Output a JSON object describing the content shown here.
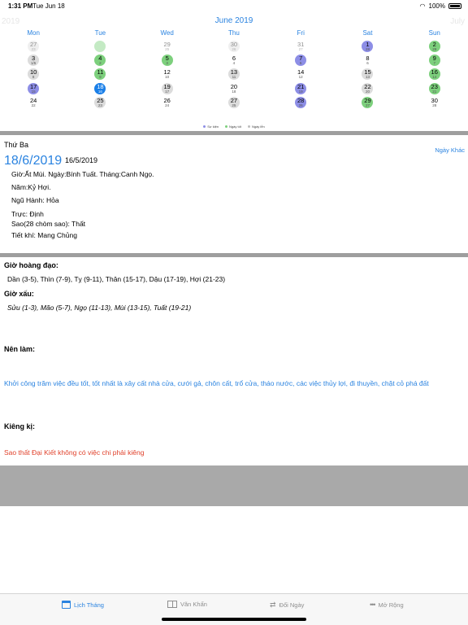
{
  "status_bar": {
    "time": "1:31 PM",
    "date": "Tue Jun 18",
    "battery": "100%"
  },
  "calendar": {
    "prev_label": "2019",
    "title": "June 2019",
    "next_label": "July",
    "weekdays": [
      "Mon",
      "Tue",
      "Wed",
      "Thu",
      "Fri",
      "Sat",
      "Sun"
    ],
    "weeks": [
      [
        {
          "d": "27",
          "l": "23",
          "c": "gray",
          "o": true
        },
        {
          "d": "",
          "l": "",
          "c": "green",
          "o": true
        },
        {
          "d": "29",
          "l": "25",
          "c": "none",
          "o": true
        },
        {
          "d": "30",
          "l": "26",
          "c": "gray",
          "o": true
        },
        {
          "d": "31",
          "l": "27",
          "c": "none",
          "o": true
        },
        {
          "d": "1",
          "l": "28",
          "c": "purple",
          "o": false
        },
        {
          "d": "2",
          "l": "29",
          "c": "green",
          "o": false
        }
      ],
      [
        {
          "d": "3",
          "l": "1/5",
          "c": "gray",
          "o": false
        },
        {
          "d": "4",
          "l": "2",
          "c": "green",
          "o": false
        },
        {
          "d": "5",
          "l": "3",
          "c": "green",
          "o": false
        },
        {
          "d": "6",
          "l": "4",
          "c": "none",
          "o": false
        },
        {
          "d": "7",
          "l": "5",
          "c": "purple",
          "o": false
        },
        {
          "d": "8",
          "l": "6",
          "c": "none",
          "o": false
        },
        {
          "d": "9",
          "l": "7",
          "c": "green",
          "o": false
        }
      ],
      [
        {
          "d": "10",
          "l": "8",
          "c": "gray",
          "o": false
        },
        {
          "d": "11",
          "l": "9",
          "c": "green",
          "o": false
        },
        {
          "d": "12",
          "l": "10",
          "c": "none",
          "o": false
        },
        {
          "d": "13",
          "l": "11",
          "c": "gray",
          "o": false
        },
        {
          "d": "14",
          "l": "12",
          "c": "none",
          "o": false
        },
        {
          "d": "15",
          "l": "13",
          "c": "gray",
          "o": false
        },
        {
          "d": "16",
          "l": "14",
          "c": "green",
          "o": false
        }
      ],
      [
        {
          "d": "17",
          "l": "15",
          "c": "purple",
          "o": false
        },
        {
          "d": "18",
          "l": "16",
          "c": "blue",
          "o": false
        },
        {
          "d": "19",
          "l": "17",
          "c": "gray",
          "o": false
        },
        {
          "d": "20",
          "l": "18",
          "c": "none",
          "o": false
        },
        {
          "d": "21",
          "l": "19",
          "c": "purple",
          "o": false
        },
        {
          "d": "22",
          "l": "20",
          "c": "gray",
          "o": false
        },
        {
          "d": "23",
          "l": "21",
          "c": "green",
          "o": false
        }
      ],
      [
        {
          "d": "24",
          "l": "22",
          "c": "none",
          "o": false
        },
        {
          "d": "25",
          "l": "23",
          "c": "gray",
          "o": false
        },
        {
          "d": "26",
          "l": "24",
          "c": "none",
          "o": false
        },
        {
          "d": "27",
          "l": "25",
          "c": "gray",
          "o": false
        },
        {
          "d": "28",
          "l": "26",
          "c": "purple",
          "o": false
        },
        {
          "d": "29",
          "l": "27",
          "c": "green",
          "o": false
        },
        {
          "d": "30",
          "l": "28",
          "c": "none",
          "o": false
        }
      ]
    ],
    "legend": [
      {
        "label": "Sự kiện",
        "color": "#8d8ee6"
      },
      {
        "label": "Ngày tốt",
        "color": "#7dd07d"
      },
      {
        "label": "Ngày lễn",
        "color": "#bdbdbd"
      }
    ]
  },
  "detail": {
    "weekday": "Thứ Ba",
    "other_day_link": "Ngày Khác",
    "solar_date": "18/6/2019",
    "lunar_date": "16/5/2019",
    "lines": [
      "Giờ:Ất Mùi. Ngày:Bính Tuất. Tháng:Canh Ngọ.",
      "Năm:Kỷ Hợi.",
      "Ngũ Hành: Hỏa",
      "Trực: Định",
      "Sao(28 chòm sao): Thất",
      "Tiết khí: Mang Chủng"
    ]
  },
  "hours": {
    "good_title": "Giờ hoàng đạo:",
    "good_text": "Dần (3-5), Thìn (7-9), Tỵ (9-11), Thân (15-17), Dậu (17-19), Hợi (21-23)",
    "bad_title": "Giờ xấu:",
    "bad_text": "Sửu (1-3), Mão (5-7), Ngọ (11-13), Mùi (13-15), Tuất (19-21)"
  },
  "should_do": {
    "title": "Nên làm:",
    "text": "Khởi công trăm việc đều tốt, tốt nhất là xây cất nhà cửa, cưới gả, chôn cất, trổ cửa, tháo nước, các việc thủy lợi, đi thuyền, chặt cỏ phá đất"
  },
  "avoid": {
    "title": "Kiêng kị:",
    "text": "Sao thất Đại Kiết không có việc chi phải kiêng"
  },
  "tabs": [
    {
      "label": "Lịch Tháng",
      "icon": "calendar-icon",
      "active": true
    },
    {
      "label": "Văn Khấn",
      "icon": "book-icon",
      "active": false
    },
    {
      "label": "Đổi Ngày",
      "icon": "swap-icon",
      "active": false
    },
    {
      "label": "Mở Rộng",
      "icon": "more-icon",
      "active": false
    }
  ],
  "colors": {
    "accent": "#2a83e0",
    "green": "#7dd07d",
    "purple": "#8d8ee6",
    "gray": "#dcdcdc",
    "selected": "#1a7fe8",
    "warning": "#e0402a"
  }
}
